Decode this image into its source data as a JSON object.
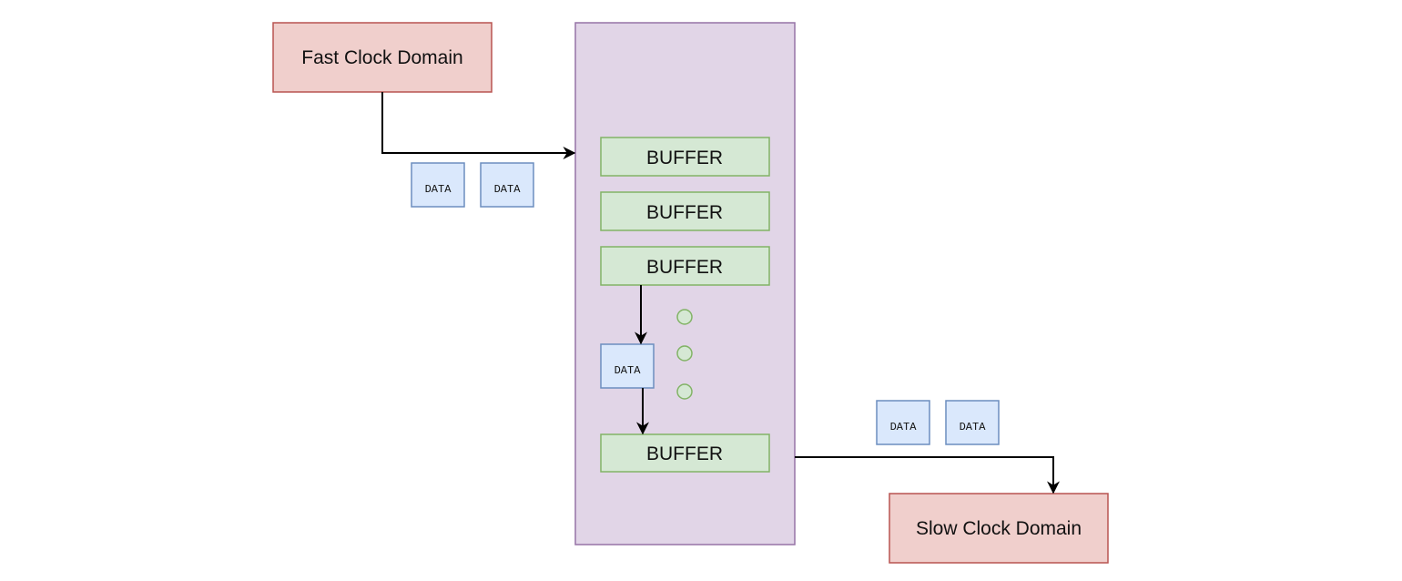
{
  "fast_domain": {
    "label": "Fast Clock Domain"
  },
  "slow_domain": {
    "label": "Slow Clock Domain"
  },
  "buffers": [
    "BUFFER",
    "BUFFER",
    "BUFFER",
    "BUFFER"
  ],
  "data_packets": [
    "DATA",
    "DATA",
    "DATA",
    "DATA",
    "DATA"
  ],
  "colors": {
    "domain_fill": "#f0cfcc",
    "domain_stroke": "#b85450",
    "fifo_fill": "#e1d5e7",
    "fifo_stroke": "#9673a6",
    "buffer_fill": "#d5e8d4",
    "buffer_stroke": "#82b366",
    "data_fill": "#dae8fc",
    "data_stroke": "#6c8ebf"
  }
}
